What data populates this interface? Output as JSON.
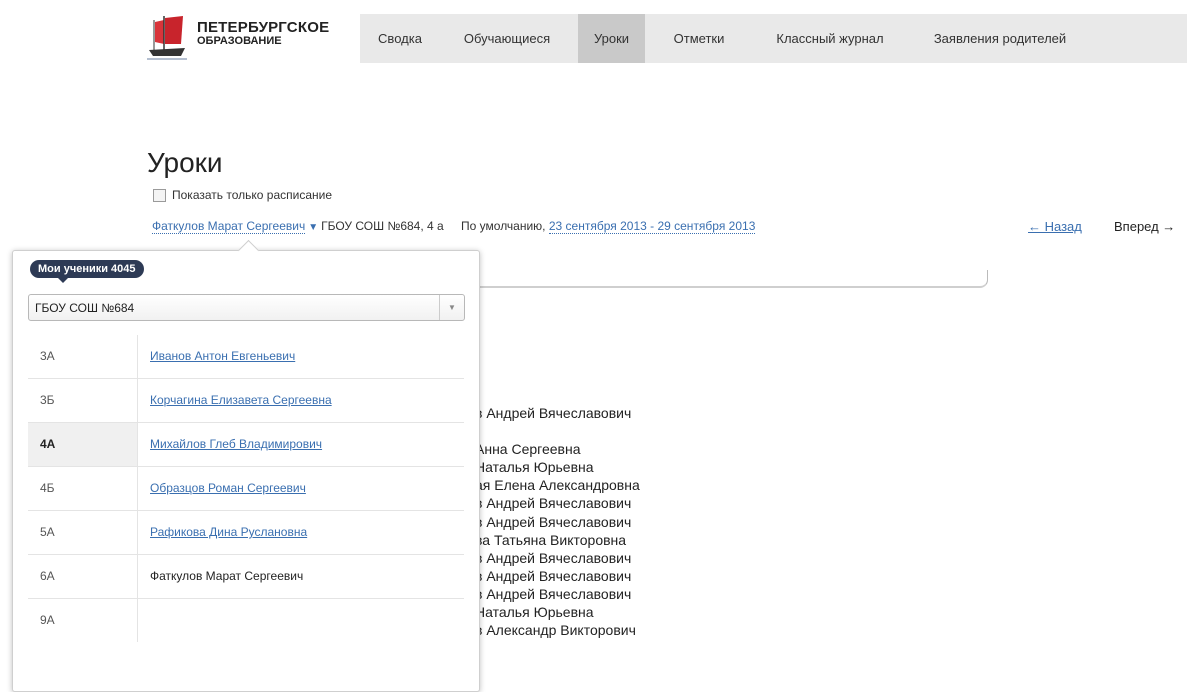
{
  "logo": {
    "line1": "ПЕТЕРБУРГСКОЕ",
    "line2": "ОБРАЗОВАНИЕ"
  },
  "nav": {
    "items": [
      {
        "label": "Сводка",
        "active": false
      },
      {
        "label": "Обучающиеся",
        "active": false
      },
      {
        "label": "Уроки",
        "active": true
      },
      {
        "label": "Отметки",
        "active": false
      },
      {
        "label": "Классный журнал",
        "active": false
      },
      {
        "label": "Заявления родителей",
        "active": false
      }
    ]
  },
  "page": {
    "title": "Уроки",
    "schedule_only_label": "Показать только расписание",
    "teacher_link": "Фаткулов Марат Сергеевич",
    "caret": "▼",
    "school_class": "ГБОУ СОШ №684, 4 а",
    "default_label": "По умолчанию,",
    "date_range": "23 сентября 2013 - 29 сентября 2013",
    "prev_label": "← Назад",
    "next_label": "Вперед →"
  },
  "background_names": [
    "в Андрей Вячеславович",
    "",
    "Анна Сергеевна",
    " Наталья Юрьевна",
    "ая Елена Александровна",
    "в Андрей Вячеславович",
    "в Андрей Вячеславович",
    "ва Татьяна Викторовна",
    "в Андрей Вячеславович",
    "в Андрей Вячеславович",
    "в Андрей Вячеславович",
    " Наталья Юрьевна",
    "в Александр Викторович"
  ],
  "popup": {
    "badge": "Мои ученики 4045",
    "school_select": "ГБОУ СОШ №684",
    "rows": [
      {
        "class": "3А",
        "student": "Иванов Антон Евгеньевич",
        "link": true,
        "active": false
      },
      {
        "class": "3Б",
        "student": "Корчагина Елизавета Сергеевна",
        "link": true,
        "active": false
      },
      {
        "class": "4А",
        "student": "Михайлов Глеб Владимирович",
        "link": true,
        "active": true
      },
      {
        "class": "4Б",
        "student": "Образцов Роман Сергеевич",
        "link": true,
        "active": false
      },
      {
        "class": "5А",
        "student": "Рафикова Дина Руслановна",
        "link": true,
        "active": false
      },
      {
        "class": "6А",
        "student": "Фаткулов Марат Сергеевич",
        "link": false,
        "active": false
      },
      {
        "class": "9А",
        "student": "",
        "link": false,
        "active": false
      }
    ]
  },
  "colors": {
    "link": "#3a6fb0",
    "badge": "#2d3a55",
    "nav_bg": "#e9e9e9",
    "nav_active": "#c9c9c9"
  }
}
